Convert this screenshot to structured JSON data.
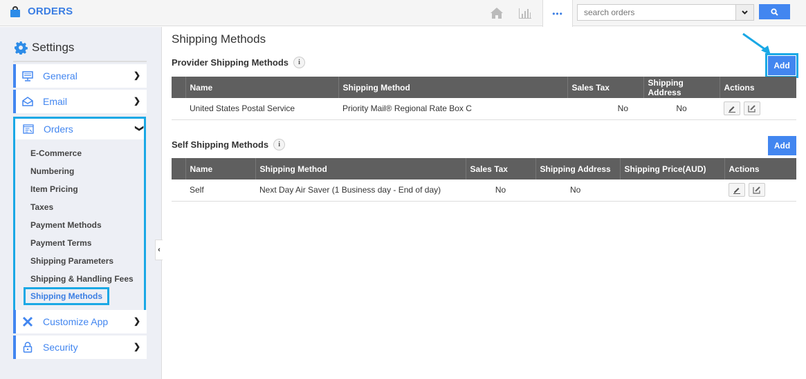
{
  "app": {
    "title": "ORDERS",
    "brand_icon": "shopping-bag-icon",
    "accent": "#4286f0",
    "highlight": "#1aa8e5"
  },
  "topbar": {
    "icons": [
      "home-icon",
      "chart-icon",
      "more-icon"
    ],
    "more_label": "•••",
    "search": {
      "placeholder": "search orders",
      "value": ""
    },
    "search_button_icon": "search-icon"
  },
  "sidebar": {
    "title": "Settings",
    "items": [
      {
        "label": "General",
        "icon": "monitor-icon"
      },
      {
        "label": "Email",
        "icon": "envelope-icon"
      },
      {
        "label": "Orders",
        "icon": "orders-icon",
        "expanded": true
      },
      {
        "label": "Customize App",
        "icon": "tools-icon"
      },
      {
        "label": "Security",
        "icon": "lock-icon"
      }
    ],
    "orders_sub": [
      "E-Commerce",
      "Numbering",
      "Item Pricing",
      "Taxes",
      "Payment Methods",
      "Payment Terms",
      "Shipping Parameters",
      "Shipping & Handling Fees",
      "Shipping Methods"
    ],
    "active_sub": "Shipping Methods",
    "collapse_glyph": "‹"
  },
  "main": {
    "title": "Shipping Methods",
    "provider": {
      "title": "Provider Shipping Methods",
      "add_label": "Add",
      "columns": [
        "",
        "Name",
        "Shipping Method",
        "Sales Tax",
        "Shipping Address",
        "Actions"
      ],
      "rows": [
        {
          "name": "United States Postal Service",
          "method": "Priority Mail® Regional Rate Box C",
          "sales_tax": "No",
          "shipping_address": "No"
        }
      ]
    },
    "self": {
      "title": "Self Shipping Methods",
      "add_label": "Add",
      "columns": [
        "",
        "Name",
        "Shipping Method",
        "Sales Tax",
        "Shipping Address",
        "Shipping Price(AUD)",
        "Actions"
      ],
      "rows": [
        {
          "name": "Self",
          "method": "Next Day Air Saver (1 Business day - End of day)",
          "sales_tax": "No",
          "shipping_address": "No",
          "shipping_price": ""
        }
      ]
    },
    "info_glyph": "i"
  }
}
